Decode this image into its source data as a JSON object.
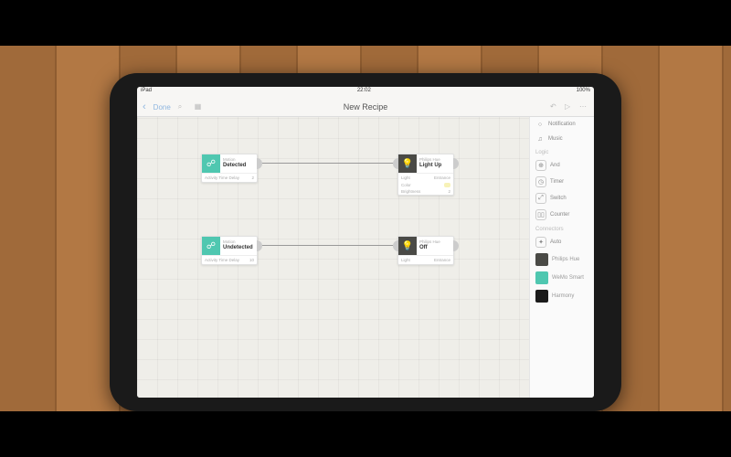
{
  "status": {
    "left": "iPad",
    "time": "22:02",
    "right": "100%"
  },
  "toolbar": {
    "back": "‹",
    "done": "Done",
    "title": "New Recipe",
    "icons": {
      "search": "⌕",
      "grid": "▦",
      "undo": "↶",
      "play": "▷",
      "more": "⋯"
    }
  },
  "nodes": {
    "trigger1": {
      "category": "Motion",
      "value": "Detected",
      "param_label": "Activity Time Delay",
      "param_value": "2"
    },
    "action1": {
      "category": "Philips Hue",
      "value": "Light Up",
      "loc_label": "Light",
      "loc_value": "Entrance",
      "p2_label": "Color",
      "p2_value": "",
      "p3_label": "Brightness",
      "p3_value": "2"
    },
    "trigger2": {
      "category": "Motion",
      "value": "Undetected",
      "param_label": "Activity Time Delay",
      "param_value": "10"
    },
    "action2": {
      "category": "Philips Hue",
      "value": "Off",
      "loc_label": "Light",
      "loc_value": "Entrance"
    }
  },
  "sidebar": {
    "items_top": [
      {
        "icon": "○",
        "label": "Notification"
      },
      {
        "icon": "♫",
        "label": "Music"
      }
    ],
    "section_logic": "Logic",
    "logic": [
      {
        "icon": "⊕",
        "label": "And"
      },
      {
        "icon": "◷",
        "label": "Timer"
      },
      {
        "icon": "⤢",
        "label": "Switch"
      },
      {
        "icon": "▯▯",
        "label": "Counter"
      }
    ],
    "section_conn": "Connectors",
    "auto": {
      "icon": "✦",
      "label": "Auto"
    },
    "connectors": [
      {
        "color": "#4a4a46",
        "label": "Philips Hue"
      },
      {
        "color": "#4fc7b0",
        "label": "WeMo Smart"
      },
      {
        "color": "#1b1b1b",
        "label": "Harmony"
      }
    ]
  }
}
